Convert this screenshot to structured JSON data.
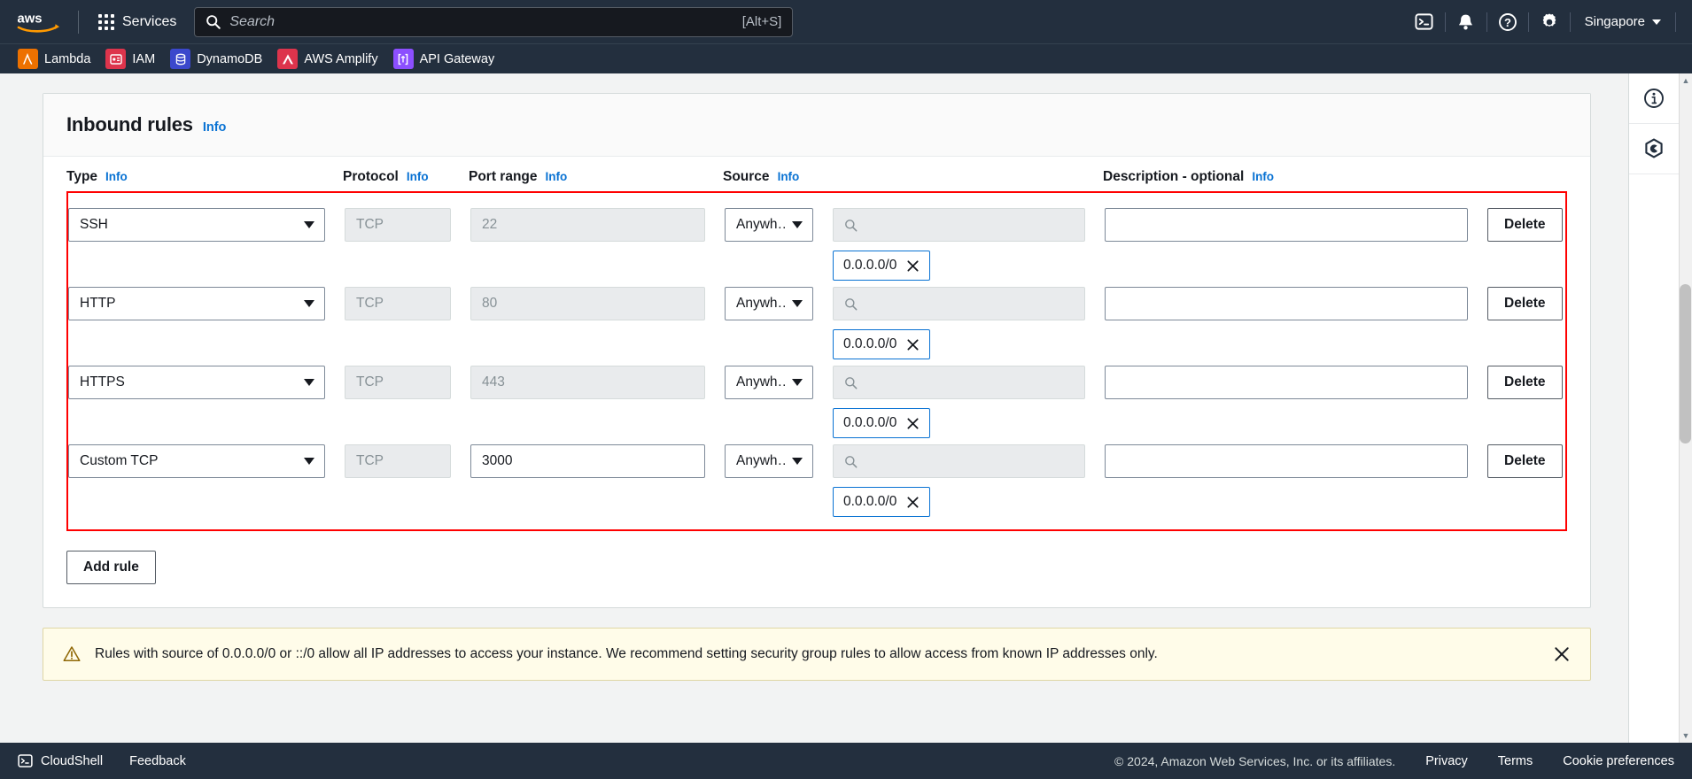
{
  "topnav": {
    "logo_alt": "aws",
    "services_label": "Services",
    "search_placeholder": "Search",
    "search_value": "",
    "search_shortcut": "[Alt+S]",
    "region_label": "Singapore",
    "icons": [
      "cloudshell-icon",
      "notifications-icon",
      "help-icon",
      "settings-icon"
    ]
  },
  "shortcuts": [
    {
      "label": "Lambda",
      "color": "#ed7100",
      "glyph": "λ"
    },
    {
      "label": "IAM",
      "color": "#dd344c",
      "glyph": "▤"
    },
    {
      "label": "DynamoDB",
      "color": "#3b48cc",
      "glyph": "⌸"
    },
    {
      "label": "AWS Amplify",
      "color": "#dd344c",
      "glyph": "△"
    },
    {
      "label": "API Gateway",
      "color": "#8c4fff",
      "glyph": "⎇"
    }
  ],
  "card": {
    "title": "Inbound rules",
    "info_label": "Info"
  },
  "columns": [
    {
      "label": "Type",
      "info": "Info"
    },
    {
      "label": "Protocol",
      "info": "Info"
    },
    {
      "label": "Port range",
      "info": "Info"
    },
    {
      "label": "Source",
      "info": "Info"
    },
    {
      "label": "Description - optional",
      "info": "Info"
    }
  ],
  "rules": [
    {
      "type": "SSH",
      "protocol": "TCP",
      "port": "22",
      "port_editable": false,
      "source_type": "Anywh…",
      "source_search_value": "",
      "cidr": "0.0.0.0/0",
      "description": "",
      "delete_label": "Delete"
    },
    {
      "type": "HTTP",
      "protocol": "TCP",
      "port": "80",
      "port_editable": false,
      "source_type": "Anywh…",
      "source_search_value": "",
      "cidr": "0.0.0.0/0",
      "description": "",
      "delete_label": "Delete"
    },
    {
      "type": "HTTPS",
      "protocol": "TCP",
      "port": "443",
      "port_editable": false,
      "source_type": "Anywh…",
      "source_search_value": "",
      "cidr": "0.0.0.0/0",
      "description": "",
      "delete_label": "Delete"
    },
    {
      "type": "Custom TCP",
      "protocol": "TCP",
      "port": "3000",
      "port_editable": true,
      "source_type": "Anywh…",
      "source_search_value": "",
      "cidr": "0.0.0.0/0",
      "description": "",
      "delete_label": "Delete"
    }
  ],
  "add_rule_label": "Add rule",
  "warning": {
    "text": "Rules with source of 0.0.0.0/0 or ::/0 allow all IP addresses to access your instance. We recommend setting security group rules to allow access from known IP addresses only."
  },
  "rail": {
    "icons": [
      "info-icon",
      "security-shield-icon"
    ]
  },
  "footer": {
    "cloudshell_label": "CloudShell",
    "feedback_label": "Feedback",
    "copyright": "© 2024, Amazon Web Services, Inc. or its affiliates.",
    "links": [
      "Privacy",
      "Terms",
      "Cookie preferences"
    ]
  },
  "highlight_color": "#ff0000"
}
